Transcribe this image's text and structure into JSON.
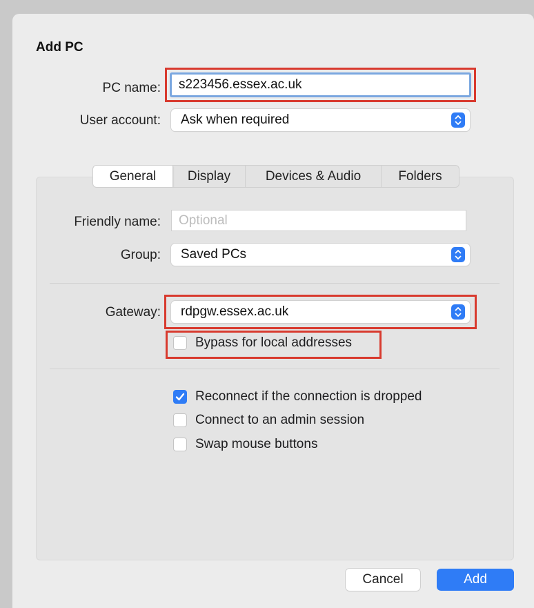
{
  "dialog": {
    "title": "Add PC"
  },
  "pc_name": {
    "label": "PC name:",
    "value": "s223456.essex.ac.uk"
  },
  "user_account": {
    "label": "User account:",
    "value": "Ask when required"
  },
  "tabs": [
    {
      "label": "General",
      "active": true
    },
    {
      "label": "Display",
      "active": false
    },
    {
      "label": "Devices & Audio",
      "active": false
    },
    {
      "label": "Folders",
      "active": false
    }
  ],
  "friendly_name": {
    "label": "Friendly name:",
    "value": "",
    "placeholder": "Optional"
  },
  "group": {
    "label": "Group:",
    "value": "Saved PCs"
  },
  "gateway": {
    "label": "Gateway:",
    "value": "rdpgw.essex.ac.uk"
  },
  "checkboxes": [
    {
      "label": "Bypass for local addresses",
      "checked": false
    },
    {
      "label": "Reconnect if the connection is dropped",
      "checked": true
    },
    {
      "label": "Connect to an admin session",
      "checked": false
    },
    {
      "label": "Swap mouse buttons",
      "checked": false
    }
  ],
  "buttons": {
    "cancel": "Cancel",
    "add": "Add"
  },
  "colors": {
    "accent": "#2f7cf6",
    "highlight": "#d83a2e"
  }
}
